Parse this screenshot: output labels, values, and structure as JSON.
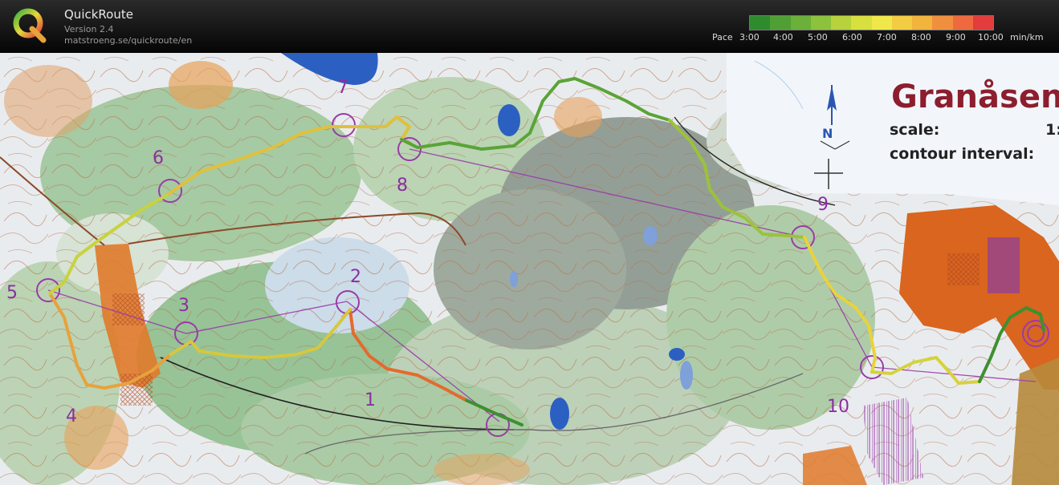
{
  "app": {
    "title": "QuickRoute",
    "version": "Version 2.4",
    "url": "matstroeng.se/quickroute/en"
  },
  "pace_legend": {
    "label": "Pace",
    "ticks": [
      "3:00",
      "4:00",
      "5:00",
      "6:00",
      "7:00",
      "8:00",
      "9:00",
      "10:00"
    ],
    "unit": "min/km",
    "colors": [
      "#2e8b2e",
      "#6ab03a",
      "#b6d23c",
      "#f0e84a",
      "#f2b43c",
      "#ee6a3e",
      "#e23c3c"
    ]
  },
  "map": {
    "title": "Granåsen",
    "scale_label": "scale:",
    "scale_value": "1:",
    "contour_label": "contour interval:",
    "north_label": "N",
    "controls": [
      "1",
      "2",
      "3",
      "4",
      "5",
      "6",
      "7",
      "8",
      "9",
      "10"
    ]
  }
}
